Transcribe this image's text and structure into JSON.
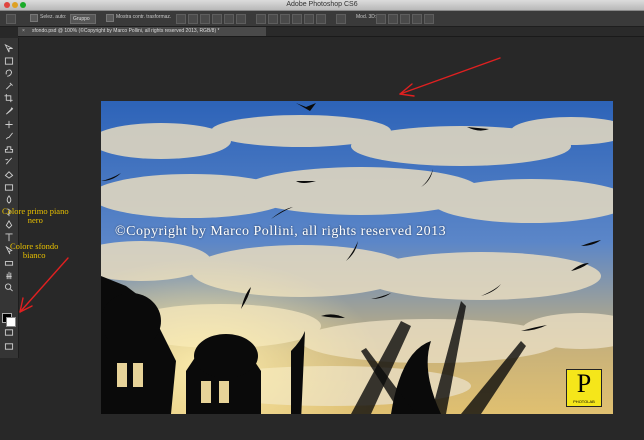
{
  "app": {
    "title": "Adobe Photoshop CS6"
  },
  "options_bar": {
    "auto_select_label": "Selez. auto:",
    "auto_select_value": "Gruppo",
    "show_transform_label": "Mostra contr. trasformaz.",
    "mode_3d_label": "Mod. 3D:"
  },
  "document": {
    "tab_label": "sfondo.psd @ 100% (©Copyright by Marco Pollini, all rights reserved 2013, RGB/8) *",
    "close_glyph": "×"
  },
  "image": {
    "watermark": "©Copyright by Marco Pollini, all rights reserved 2013",
    "logo_letter": "P",
    "logo_name": "PHOTOLAB"
  },
  "annotations": {
    "foreground_line1": "Colore primo piano",
    "foreground_line2": "nero",
    "background_line1": "Colore sfondo",
    "background_line2": "bianco"
  },
  "colors": {
    "annotation_text": "#e8c000",
    "arrow": "#e02020",
    "foreground_swatch": "#000000",
    "background_swatch": "#ffffff",
    "logo_bg": "#f5e61a"
  },
  "tools": [
    "move-icon",
    "marquee-icon",
    "lasso-icon",
    "quick-select-icon",
    "crop-icon",
    "eyedropper-icon",
    "healing-icon",
    "brush-icon",
    "clone-stamp-icon",
    "history-brush-icon",
    "eraser-icon",
    "gradient-icon",
    "blur-icon",
    "dodge-icon",
    "pen-icon",
    "type-icon",
    "path-select-icon",
    "shape-icon",
    "hand-icon",
    "zoom-icon"
  ]
}
